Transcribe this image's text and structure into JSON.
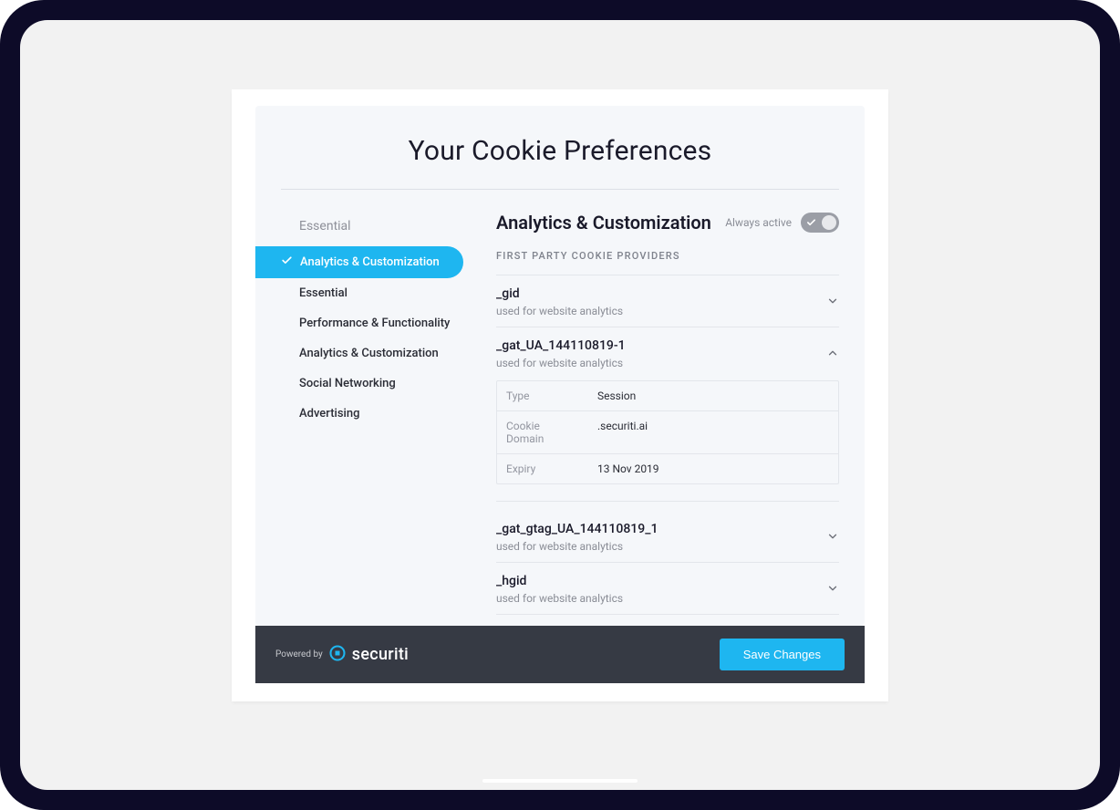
{
  "title": "Your Cookie Preferences",
  "sidebar": {
    "heading": "Essential",
    "items": [
      {
        "label": "Analytics & Customization",
        "active": true
      },
      {
        "label": "Essential",
        "active": false
      },
      {
        "label": "Performance & Functionality",
        "active": false
      },
      {
        "label": "Analytics & Customization",
        "active": false
      },
      {
        "label": "Social Networking",
        "active": false
      },
      {
        "label": "Advertising",
        "active": false
      }
    ]
  },
  "content": {
    "heading": "Analytics & Customization",
    "always_active_label": "Always active",
    "section_label": "FIRST PARTY COOKIE PROVIDERS",
    "cookies": [
      {
        "name": "_gid",
        "desc": "used for website analytics",
        "expanded": false
      },
      {
        "name": "_gat_UA_144110819-1",
        "desc": "used for website analytics",
        "expanded": true,
        "details": [
          {
            "key": "Type",
            "value": "Session"
          },
          {
            "key": "Cookie Domain",
            "value": ".securiti.ai"
          },
          {
            "key": "Expiry",
            "value": "13 Nov 2019"
          }
        ]
      },
      {
        "name": "_gat_gtag_UA_144110819_1",
        "desc": "used for website analytics",
        "expanded": false
      },
      {
        "name": "_hgid",
        "desc": "used for website analytics",
        "expanded": false
      }
    ]
  },
  "footer": {
    "powered_by": "Powered by",
    "brand": "securiti",
    "save_label": "Save Changes"
  }
}
